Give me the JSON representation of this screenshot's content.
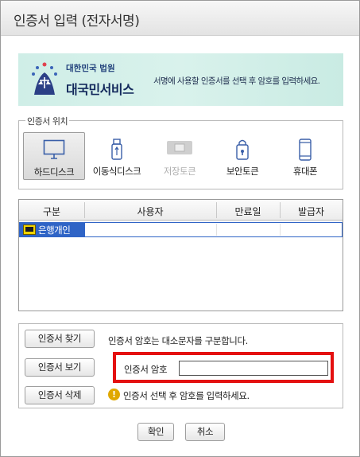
{
  "window": {
    "title": "인증서 입력 (전자서명)"
  },
  "banner": {
    "logo_top": "대한민국 법원",
    "logo_bottom": "대국민서비스",
    "notice": "서명에 사용할 인증서를 선택 후 암호를 입력하세요."
  },
  "location": {
    "legend": "인증서 위치",
    "items": [
      {
        "label": "하드디스크",
        "icon": "monitor-icon",
        "selected": true,
        "enabled": true
      },
      {
        "label": "이동식디스크",
        "icon": "usb-icon",
        "selected": false,
        "enabled": true
      },
      {
        "label": "저장토큰",
        "icon": "smartcard-icon",
        "selected": false,
        "enabled": false
      },
      {
        "label": "보안토큰",
        "icon": "lock-token-icon",
        "selected": false,
        "enabled": true
      },
      {
        "label": "휴대폰",
        "icon": "phone-icon",
        "selected": false,
        "enabled": true
      }
    ]
  },
  "cert_list": {
    "columns": [
      "구분",
      "사용자",
      "만료일",
      "발급자"
    ],
    "rows": [
      {
        "type": "은행개인",
        "user": "",
        "expiry": "",
        "issuer": "",
        "selected": true
      }
    ]
  },
  "actions": {
    "find": "인증서 찾기",
    "view": "인증서 보기",
    "delete": "인증서 삭제",
    "case_note": "인증서 암호는 대소문자를 구분합니다.",
    "password_label": "인증서 암호",
    "password_value": "",
    "warning": "인증서 선택 후 암호를 입력하세요."
  },
  "footer": {
    "ok": "확인",
    "cancel": "취소"
  },
  "colors": {
    "selection": "#2f64c6",
    "highlight": "#e41010",
    "banner": "#cfeee7"
  }
}
